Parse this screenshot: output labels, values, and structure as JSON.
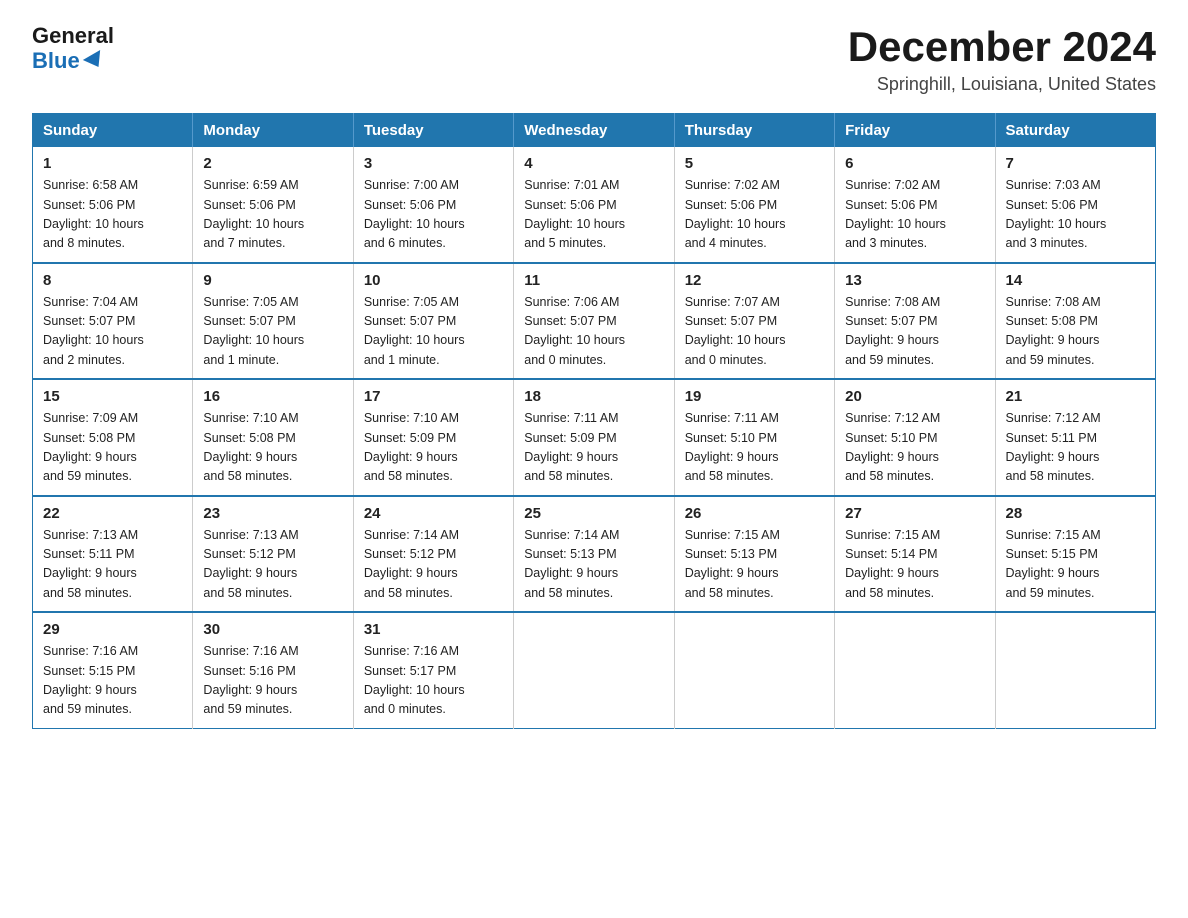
{
  "logo": {
    "general": "General",
    "blue": "Blue"
  },
  "title": {
    "month_year": "December 2024",
    "location": "Springhill, Louisiana, United States"
  },
  "days_of_week": [
    "Sunday",
    "Monday",
    "Tuesday",
    "Wednesday",
    "Thursday",
    "Friday",
    "Saturday"
  ],
  "weeks": [
    [
      {
        "day": "1",
        "info": "Sunrise: 6:58 AM\nSunset: 5:06 PM\nDaylight: 10 hours\nand 8 minutes."
      },
      {
        "day": "2",
        "info": "Sunrise: 6:59 AM\nSunset: 5:06 PM\nDaylight: 10 hours\nand 7 minutes."
      },
      {
        "day": "3",
        "info": "Sunrise: 7:00 AM\nSunset: 5:06 PM\nDaylight: 10 hours\nand 6 minutes."
      },
      {
        "day": "4",
        "info": "Sunrise: 7:01 AM\nSunset: 5:06 PM\nDaylight: 10 hours\nand 5 minutes."
      },
      {
        "day": "5",
        "info": "Sunrise: 7:02 AM\nSunset: 5:06 PM\nDaylight: 10 hours\nand 4 minutes."
      },
      {
        "day": "6",
        "info": "Sunrise: 7:02 AM\nSunset: 5:06 PM\nDaylight: 10 hours\nand 3 minutes."
      },
      {
        "day": "7",
        "info": "Sunrise: 7:03 AM\nSunset: 5:06 PM\nDaylight: 10 hours\nand 3 minutes."
      }
    ],
    [
      {
        "day": "8",
        "info": "Sunrise: 7:04 AM\nSunset: 5:07 PM\nDaylight: 10 hours\nand 2 minutes."
      },
      {
        "day": "9",
        "info": "Sunrise: 7:05 AM\nSunset: 5:07 PM\nDaylight: 10 hours\nand 1 minute."
      },
      {
        "day": "10",
        "info": "Sunrise: 7:05 AM\nSunset: 5:07 PM\nDaylight: 10 hours\nand 1 minute."
      },
      {
        "day": "11",
        "info": "Sunrise: 7:06 AM\nSunset: 5:07 PM\nDaylight: 10 hours\nand 0 minutes."
      },
      {
        "day": "12",
        "info": "Sunrise: 7:07 AM\nSunset: 5:07 PM\nDaylight: 10 hours\nand 0 minutes."
      },
      {
        "day": "13",
        "info": "Sunrise: 7:08 AM\nSunset: 5:07 PM\nDaylight: 9 hours\nand 59 minutes."
      },
      {
        "day": "14",
        "info": "Sunrise: 7:08 AM\nSunset: 5:08 PM\nDaylight: 9 hours\nand 59 minutes."
      }
    ],
    [
      {
        "day": "15",
        "info": "Sunrise: 7:09 AM\nSunset: 5:08 PM\nDaylight: 9 hours\nand 59 minutes."
      },
      {
        "day": "16",
        "info": "Sunrise: 7:10 AM\nSunset: 5:08 PM\nDaylight: 9 hours\nand 58 minutes."
      },
      {
        "day": "17",
        "info": "Sunrise: 7:10 AM\nSunset: 5:09 PM\nDaylight: 9 hours\nand 58 minutes."
      },
      {
        "day": "18",
        "info": "Sunrise: 7:11 AM\nSunset: 5:09 PM\nDaylight: 9 hours\nand 58 minutes."
      },
      {
        "day": "19",
        "info": "Sunrise: 7:11 AM\nSunset: 5:10 PM\nDaylight: 9 hours\nand 58 minutes."
      },
      {
        "day": "20",
        "info": "Sunrise: 7:12 AM\nSunset: 5:10 PM\nDaylight: 9 hours\nand 58 minutes."
      },
      {
        "day": "21",
        "info": "Sunrise: 7:12 AM\nSunset: 5:11 PM\nDaylight: 9 hours\nand 58 minutes."
      }
    ],
    [
      {
        "day": "22",
        "info": "Sunrise: 7:13 AM\nSunset: 5:11 PM\nDaylight: 9 hours\nand 58 minutes."
      },
      {
        "day": "23",
        "info": "Sunrise: 7:13 AM\nSunset: 5:12 PM\nDaylight: 9 hours\nand 58 minutes."
      },
      {
        "day": "24",
        "info": "Sunrise: 7:14 AM\nSunset: 5:12 PM\nDaylight: 9 hours\nand 58 minutes."
      },
      {
        "day": "25",
        "info": "Sunrise: 7:14 AM\nSunset: 5:13 PM\nDaylight: 9 hours\nand 58 minutes."
      },
      {
        "day": "26",
        "info": "Sunrise: 7:15 AM\nSunset: 5:13 PM\nDaylight: 9 hours\nand 58 minutes."
      },
      {
        "day": "27",
        "info": "Sunrise: 7:15 AM\nSunset: 5:14 PM\nDaylight: 9 hours\nand 58 minutes."
      },
      {
        "day": "28",
        "info": "Sunrise: 7:15 AM\nSunset: 5:15 PM\nDaylight: 9 hours\nand 59 minutes."
      }
    ],
    [
      {
        "day": "29",
        "info": "Sunrise: 7:16 AM\nSunset: 5:15 PM\nDaylight: 9 hours\nand 59 minutes."
      },
      {
        "day": "30",
        "info": "Sunrise: 7:16 AM\nSunset: 5:16 PM\nDaylight: 9 hours\nand 59 minutes."
      },
      {
        "day": "31",
        "info": "Sunrise: 7:16 AM\nSunset: 5:17 PM\nDaylight: 10 hours\nand 0 minutes."
      },
      {
        "day": "",
        "info": ""
      },
      {
        "day": "",
        "info": ""
      },
      {
        "day": "",
        "info": ""
      },
      {
        "day": "",
        "info": ""
      }
    ]
  ]
}
